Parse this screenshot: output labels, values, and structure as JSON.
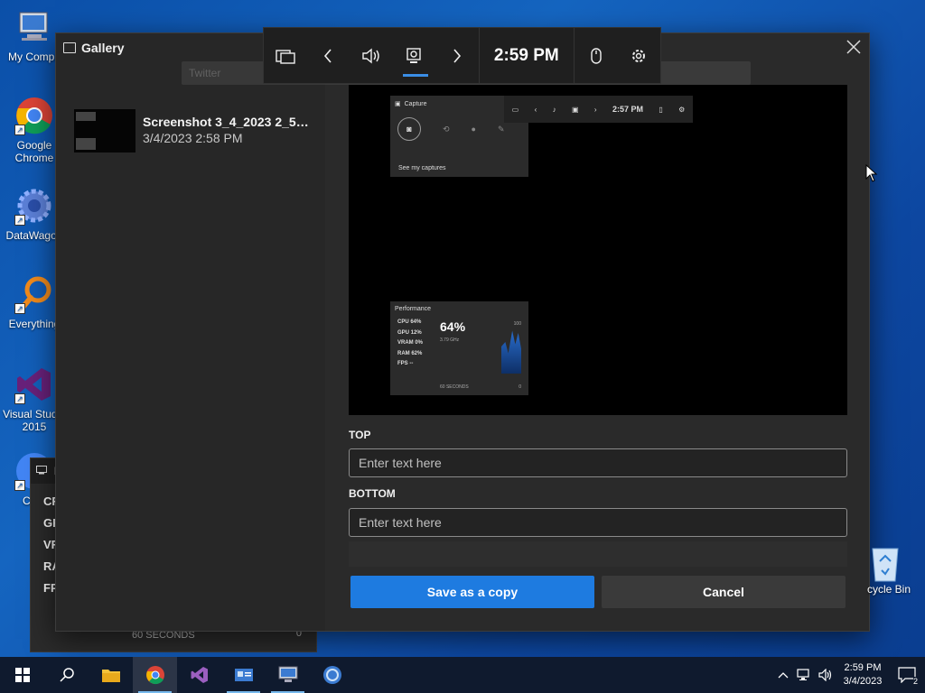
{
  "desktop": {
    "icons": [
      {
        "label": "My Compu"
      },
      {
        "label": "Google Chrome"
      },
      {
        "label": "DataWagon"
      },
      {
        "label": "Everything"
      },
      {
        "label": "Visual Studio 2015"
      },
      {
        "label": "Chro"
      }
    ],
    "recycle_bin": "cycle Bin"
  },
  "perf_widget": {
    "rows": [
      "CF",
      "GF",
      "VR",
      "RA",
      "FP"
    ],
    "footer": "60 SECONDS",
    "min": "0"
  },
  "gallery": {
    "title": "Gallery",
    "item": {
      "name": "Screenshot 3_4_2023 2_57_...",
      "date": "3/4/2023 2:58 PM"
    },
    "preview": {
      "capture_title": "Capture",
      "see_captures": "See my captures",
      "mini_time": "2:57 PM",
      "perf_title": "Performance",
      "perf_rows": [
        "CPU  64%",
        "GPU  12%",
        "VRAM   0%",
        "RAM  62%",
        "FPS  --"
      ],
      "perf_big": "64%",
      "perf_ghz": "3.79 GHz",
      "perf_max": "100",
      "perf_secs": "60 SECONDS",
      "perf_min": "0"
    },
    "top_label": "TOP",
    "top_placeholder": "Enter text here",
    "bottom_label": "BOTTOM",
    "bottom_placeholder": "Enter text here",
    "save_label": "Save as a copy",
    "cancel_label": "Cancel",
    "ghost_search": "Twitter"
  },
  "gamebar": {
    "time": "2:59 PM"
  },
  "taskbar": {
    "clock_time": "2:59 PM",
    "clock_date": "3/4/2023",
    "notification_count": "2"
  },
  "colors": {
    "accent": "#1e7be0",
    "gamebar_indicator": "#3a8ee6"
  }
}
